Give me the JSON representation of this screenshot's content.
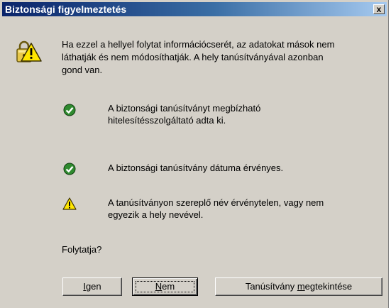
{
  "window": {
    "title": "Biztonsági figyelmeztetés",
    "close_label": "x"
  },
  "message": {
    "line1": "Ha ezzel a hellyel folytat információcserét, az adatokat mások nem",
    "line2": "láthatják és nem módosíthatják. A hely tanúsítványával azonban",
    "line3": "gond van."
  },
  "checks": [
    {
      "icon": "check-ok-icon",
      "lines": [
        "A biztonsági tanúsítványt megbízható",
        "hitelesítésszolgáltató adta ki."
      ]
    },
    {
      "icon": "check-ok-icon",
      "lines": [
        "A biztonsági tanúsítvány dátuma érvényes."
      ]
    },
    {
      "icon": "warning-icon",
      "lines": [
        "A tanúsítványon szereplő név érvénytelen, vagy nem",
        "egyezik a hely nevével."
      ]
    }
  ],
  "question": "Folytatja?",
  "buttons": {
    "yes": {
      "access_key": "I",
      "rest": "gen"
    },
    "no": {
      "access_key": "N",
      "rest": "em"
    },
    "view_cert": {
      "prefix": "Tanúsítvány ",
      "access_key": "m",
      "rest": "egtekintése"
    }
  },
  "colors": {
    "dialog_bg": "#d4d0c8",
    "title_start": "#0a246a",
    "title_end": "#a6caf0",
    "ok_green": "#2f8a2f",
    "warning_yellow": "#ffd700"
  }
}
